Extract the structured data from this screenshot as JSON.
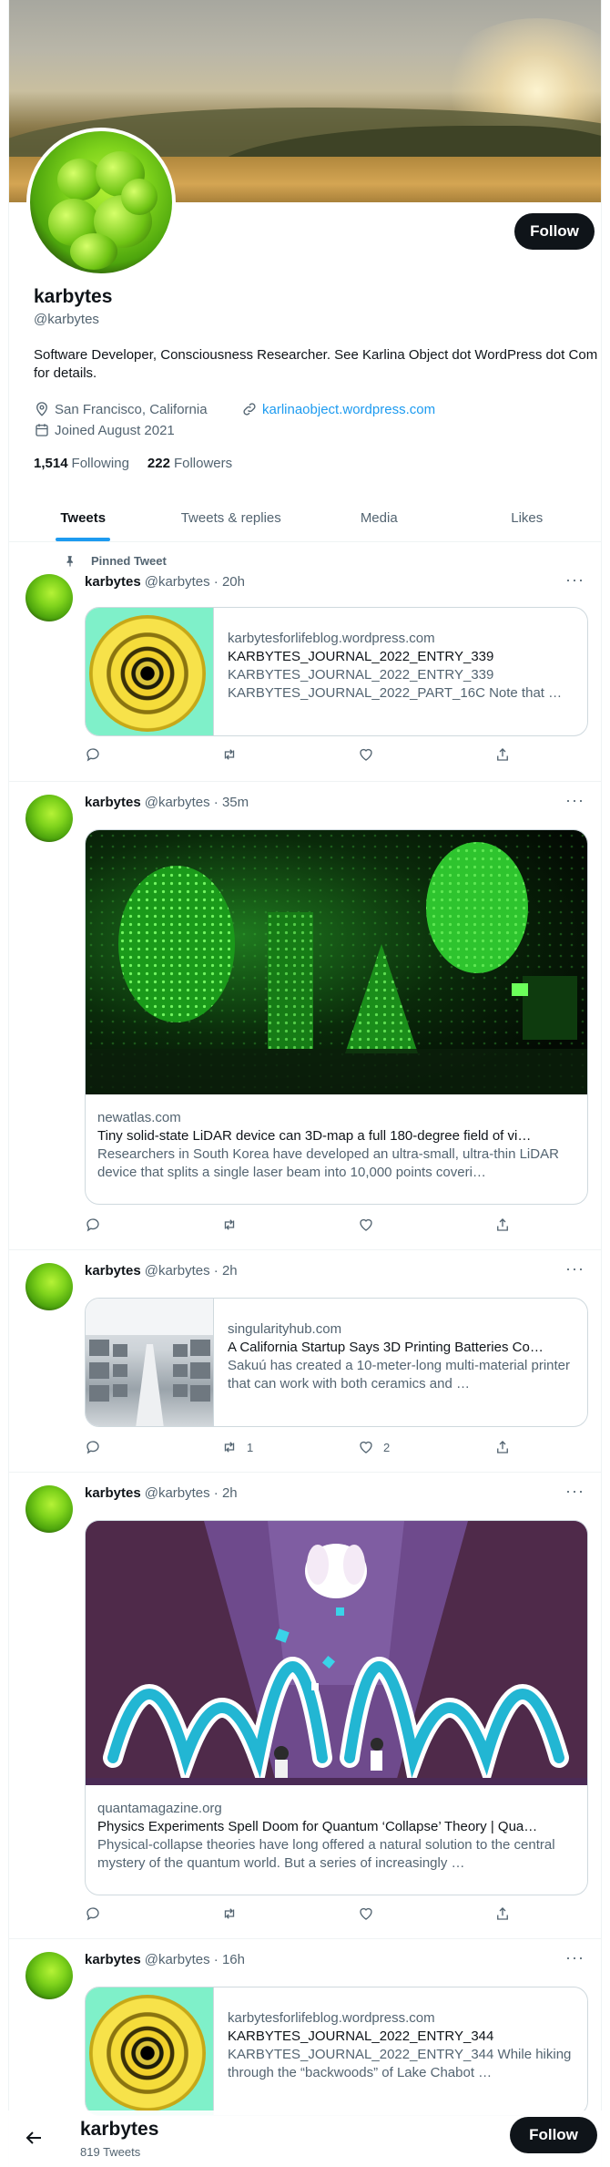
{
  "profile": {
    "name": "karbytes",
    "handle": "@karbytes",
    "follow_label": "Follow",
    "bio": "Software Developer, Consciousness Researcher. See Karlina Object dot WordPress dot Com for details.",
    "location": "San Francisco, California",
    "website": "karlinaobject.wordpress.com",
    "joined": "Joined August 2021",
    "following_count": "1,514",
    "following_label": "Following",
    "followers_count": "222",
    "followers_label": "Followers"
  },
  "tabs": [
    {
      "label": "Tweets"
    },
    {
      "label": "Tweets & replies"
    },
    {
      "label": "Media"
    },
    {
      "label": "Likes"
    }
  ],
  "pinned_label": "Pinned Tweet",
  "more_glyph": "···",
  "tweets": [
    {
      "name": "karbytes",
      "meta": "@karbytes · 20h",
      "card": {
        "domain": "karbytesforlifeblog.wordpress.com",
        "title": "KARBYTES_JOURNAL_2022_ENTRY_339",
        "desc": "KARBYTES_JOURNAL_2022_ENTRY_339 KARBYTES_JOURNAL_2022_PART_16C Note that …"
      },
      "stats": {
        "reply": "",
        "retweet": "",
        "like": ""
      }
    },
    {
      "name": "karbytes",
      "meta": "@karbytes · 35m",
      "card": {
        "domain": "newatlas.com",
        "title": "Tiny solid-state LiDAR device can 3D-map a full 180-degree field of vi…",
        "desc": "Researchers in South Korea have developed an ultra-small, ultra-thin LiDAR device that splits a single laser beam into 10,000 points coveri…"
      },
      "stats": {
        "reply": "",
        "retweet": "",
        "like": ""
      }
    },
    {
      "name": "karbytes",
      "meta": "@karbytes · 2h",
      "card": {
        "domain": "singularityhub.com",
        "title": "A California Startup Says 3D Printing Batteries Co…",
        "desc": "Sakuú has created a 10-meter-long multi-material printer that can work with both ceramics and …"
      },
      "stats": {
        "reply": "",
        "retweet": "1",
        "like": "2"
      }
    },
    {
      "name": "karbytes",
      "meta": "@karbytes · 2h",
      "card": {
        "domain": "quantamagazine.org",
        "title": "Physics Experiments Spell Doom for Quantum ‘Collapse’ Theory | Qua…",
        "desc": "Physical-collapse theories have long offered a natural solution to the central mystery of the quantum world. But a series of increasingly …"
      },
      "stats": {
        "reply": "",
        "retweet": "",
        "like": ""
      }
    },
    {
      "name": "karbytes",
      "meta": "@karbytes · 16h",
      "card": {
        "domain": "karbytesforlifeblog.wordpress.com",
        "title": "KARBYTES_JOURNAL_2022_ENTRY_344",
        "desc": "KARBYTES_JOURNAL_2022_ENTRY_344 While hiking through the “backwoods” of Lake Chabot …"
      },
      "stats": {
        "reply": "",
        "retweet": "",
        "like": ""
      }
    }
  ],
  "bottom_bar": {
    "name": "karbytes",
    "tweet_count": "819 Tweets",
    "follow_label": "Follow"
  },
  "colors": {
    "accent": "#1d9bf0",
    "text": "#0f1419",
    "secondary": "#536471",
    "follow_bg": "#0f1419"
  }
}
